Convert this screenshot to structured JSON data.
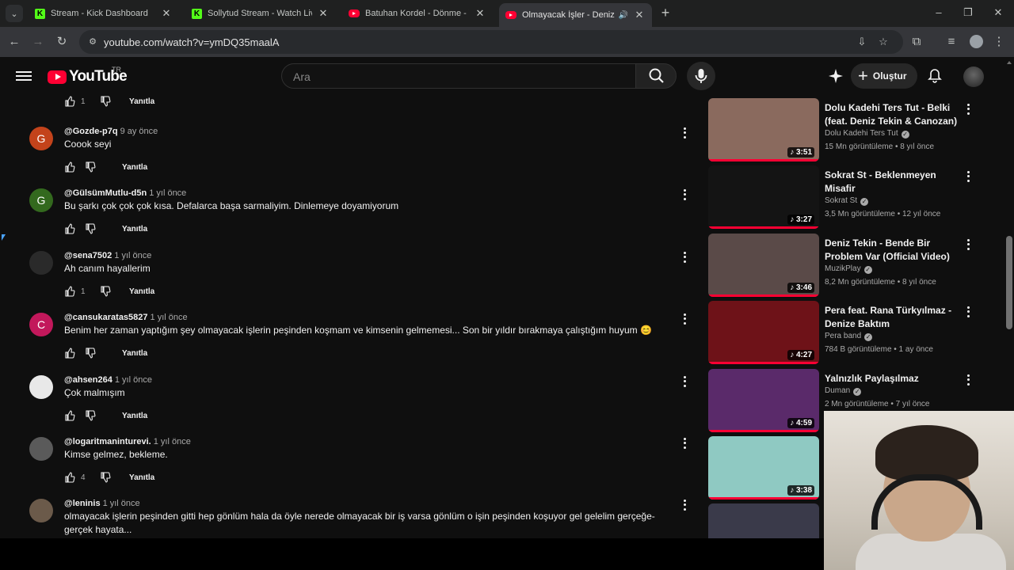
{
  "browser": {
    "tabs": [
      {
        "title": "Stream - Kick Dashboard",
        "favicon": "kick-icon"
      },
      {
        "title": "Sollytud Stream - Watch Live on Kick",
        "favicon": "kick-icon"
      },
      {
        "title": "Batuhan Kordel - Dönme - YouTube",
        "favicon": "youtube-icon"
      },
      {
        "title": "Olmayacak İşler - Deniz Tekin",
        "favicon": "youtube-icon"
      }
    ],
    "url": "youtube.com/watch?v=ymDQ35maalA"
  },
  "header": {
    "logo_text": "YouTube",
    "country_code": "TR",
    "search_placeholder": "Ara",
    "create_label": "Oluştur"
  },
  "comments": [
    {
      "author": "",
      "time": "",
      "text": "",
      "likes": "1",
      "reply_label": "Yanıtla"
    },
    {
      "author": "@Gozde-p7q",
      "time": "9 ay önce",
      "text": "Coook seyi",
      "likes": "",
      "reply_label": "Yanıtla",
      "initial": "G",
      "avatar_color": "#c3431b"
    },
    {
      "author": "@GülsümMutlu-d5n",
      "time": "1 yıl önce",
      "text": "Bu şarkı çok çok çok kısa. Defalarca başa sarmaliyim. Dinlemeye doyamiyorum",
      "likes": "",
      "reply_label": "Yanıtla",
      "initial": "G",
      "avatar_color": "#33691e"
    },
    {
      "author": "@sena7502",
      "time": "1 yıl önce",
      "text": "Ah canım hayallerim",
      "likes": "1",
      "reply_label": "Yanıtla",
      "initial": "",
      "avatar_color": "#2a2a2a"
    },
    {
      "author": "@cansukaratas5827",
      "time": "1 yıl önce",
      "text": "Benim her zaman yaptığım şey olmayacak işlerin peşinden koşmam ve kimsenin gelmemesi... Son bir yıldır bırakmaya çalıştığım huyum 😊",
      "likes": "",
      "reply_label": "Yanıtla",
      "initial": "C",
      "avatar_color": "#c2185b"
    },
    {
      "author": "@ahsen264",
      "time": "1 yıl önce",
      "text": "Çok malmışım",
      "likes": "",
      "reply_label": "Yanıtla",
      "initial": "",
      "avatar_color": "#e8e8e8"
    },
    {
      "author": "@logaritmaninturevi.",
      "time": "1 yıl önce",
      "text": "Kimse gelmez, bekleme.",
      "likes": "4",
      "reply_label": "Yanıtla",
      "initial": "",
      "avatar_color": "#5a5a5a"
    },
    {
      "author": "@leninis",
      "time": "1 yıl önce",
      "text": "olmayacak işlerin peşinden gitti hep gönlüm hala da öyle nerede olmayacak bir iş varsa gönlüm o işin peşinden koşuyor gel gelelim gerçeğe-gerçek hayata...",
      "likes": "",
      "reply_label": "",
      "initial": "",
      "avatar_color": "#6b5a4a"
    }
  ],
  "recommendations": [
    {
      "title": "Dolu Kadehi Ters Tut - Belki (feat. Deniz Tekin & Canozan)",
      "channel": "Dolu Kadehi Ters Tut",
      "verified": true,
      "stats": "15 Mn görüntüleme • 8 yıl önce",
      "duration": "3:51",
      "thumb_color": "#8a6a5e"
    },
    {
      "title": "Sokrat St - Beklenmeyen Misafir",
      "channel": "Sokrat St",
      "verified": true,
      "stats": "3,5 Mn görüntüleme • 12 yıl önce",
      "duration": "3:27",
      "thumb_color": "#141414"
    },
    {
      "title": "Deniz Tekin - Bende Bir Problem Var (Official Video)",
      "channel": "MuzikPlay",
      "verified": true,
      "stats": "8,2 Mn görüntüleme • 8 yıl önce",
      "duration": "3:46",
      "thumb_color": "#5a4a48"
    },
    {
      "title": "Pera feat. Rana Türkyılmaz - Denize Baktım",
      "channel": "Pera band",
      "verified": true,
      "stats": "784 B görüntüleme • 1 ay önce",
      "duration": "4:27",
      "thumb_color": "#6e1218"
    },
    {
      "title": "Yalnızlık Paylaşılmaz",
      "channel": "Duman",
      "verified": true,
      "stats": "2 Mn görüntüleme • 7 yıl önce",
      "duration": "4:59",
      "thumb_color": "#5a2a6a"
    },
    {
      "title": "",
      "channel": "",
      "verified": false,
      "stats": "",
      "duration": "3:38",
      "thumb_color": "#8fc9c2"
    },
    {
      "title": "",
      "channel": "",
      "verified": false,
      "stats": "",
      "duration": "",
      "thumb_color": "#3a3a4a"
    }
  ]
}
